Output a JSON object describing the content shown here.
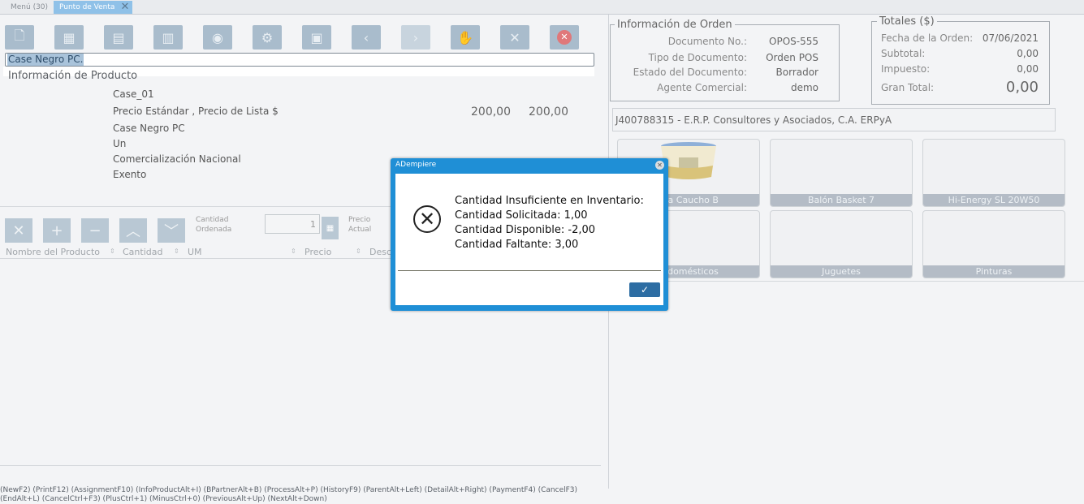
{
  "tabs": {
    "menu": "Menú (30)",
    "active": "Punto de Venta"
  },
  "search": {
    "value": "Case Negro PC."
  },
  "product_info": {
    "title": "Información de Producto",
    "code": "Case_01",
    "price_label": "Precio Estándar , Precio de Lista $",
    "price_std": "200,00",
    "price_list": "200,00",
    "name": "Case Negro PC",
    "uom": "Un",
    "category": "Comercialización Nacional",
    "tax": "Exento"
  },
  "line_controls": {
    "qty_label_1": "Cantidad",
    "qty_label_2": "Ordenada",
    "qty_value": "1",
    "price_label_1": "Precio",
    "price_label_2": "Actual"
  },
  "table": {
    "columns": [
      "Nombre del Producto",
      "Cantidad",
      "UM",
      "Precio",
      "Descu"
    ]
  },
  "order_info": {
    "title": "Información de Orden",
    "doc_no_label": "Documento No.:",
    "doc_no": "OPOS-555",
    "doc_type_label": "Tipo de Documento:",
    "doc_type": "Orden POS",
    "status_label": "Estado del Documento:",
    "status": "Borrador",
    "agent_label": "Agente Comercial:",
    "agent": "demo"
  },
  "totals": {
    "title": "Totales ($)",
    "date_label": "Fecha de la Orden:",
    "date": "07/06/2021",
    "subtotal_label": "Subtotal:",
    "subtotal": "0,00",
    "tax_label": "Impuesto:",
    "tax": "0,00",
    "grand_label": "Gran Total:",
    "grand": "0,00"
  },
  "business_partner": "J400788315 - E.R.P. Consultores y Asociados, C.A. ERPyA",
  "tiles": [
    {
      "label": "ura Caucho B"
    },
    {
      "label": "Balón Basket 7"
    },
    {
      "label": "Hi-Energy SL 20W50"
    },
    {
      "label": "rodomésticos"
    },
    {
      "label": "Juguetes"
    },
    {
      "label": "Pinturas"
    }
  ],
  "footer": {
    "line1": "(NewF2) (PrintF12) (AssignmentF10) (InfoProductAlt+I) (BPartnerAlt+B) (ProcessAlt+P) (HistoryF9) (ParentAlt+Left) (DetailAlt+Right) (PaymentF4) (CancelF3)",
    "line2": "(EndAlt+L) (CancelCtrl+F3) (PlusCtrl+1) (MinusCtrl+0) (PreviousAlt+Up) (NextAlt+Down)"
  },
  "dialog": {
    "title": "ADempiere",
    "line1": "Cantidad Insuficiente en Inventario:",
    "line2": "Cantidad Solicitada: 1,00",
    "line3": "Cantidad Disponible: -2,00",
    "line4": "Cantidad Faltante: 3,00",
    "ok": "✓"
  },
  "colors": {
    "accent": "#1f8fd6",
    "toolbar": "#a9bccc",
    "tile_caption": "#b4bcc6"
  }
}
